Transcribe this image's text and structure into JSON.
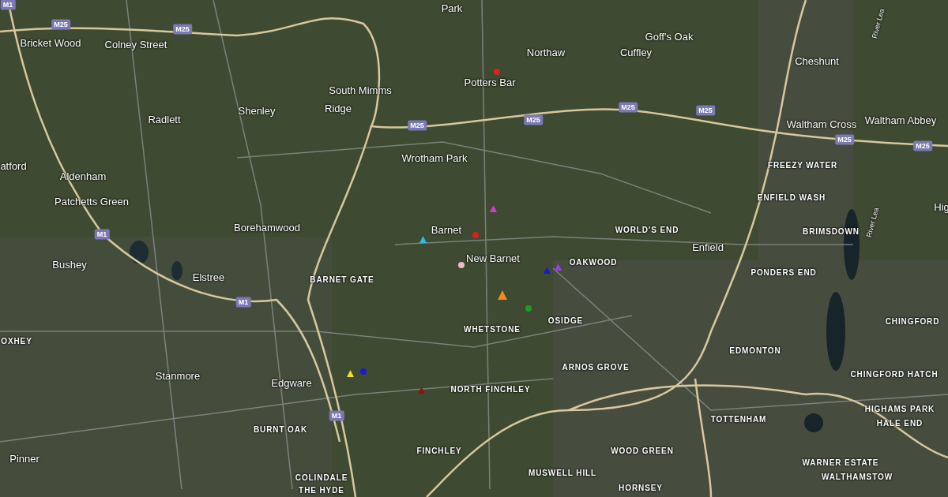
{
  "map": {
    "labels": [
      {
        "text": "Park",
        "kind": "town"
      },
      {
        "text": "Bricket Wood",
        "kind": "town"
      },
      {
        "text": "Colney Street",
        "kind": "town"
      },
      {
        "text": "Goff's Oak",
        "kind": "town"
      },
      {
        "text": "Northaw",
        "kind": "town"
      },
      {
        "text": "Cuffley",
        "kind": "town"
      },
      {
        "text": "Cheshunt",
        "kind": "town"
      },
      {
        "text": "Potters Bar",
        "kind": "town"
      },
      {
        "text": "South Mimms",
        "kind": "town"
      },
      {
        "text": "Shenley",
        "kind": "town"
      },
      {
        "text": "Ridge",
        "kind": "town"
      },
      {
        "text": "Radlett",
        "kind": "town"
      },
      {
        "text": "Waltham Cross",
        "kind": "town"
      },
      {
        "text": "Waltham Abbey",
        "kind": "town"
      },
      {
        "text": "Wrotham Park",
        "kind": "town"
      },
      {
        "text": "atford",
        "kind": "town"
      },
      {
        "text": "Aldenham",
        "kind": "town"
      },
      {
        "text": "Patchetts Green",
        "kind": "town"
      },
      {
        "text": "Borehamwood",
        "kind": "town"
      },
      {
        "text": "Barnet",
        "kind": "town"
      },
      {
        "text": "New Barnet",
        "kind": "town"
      },
      {
        "text": "Enfield",
        "kind": "town"
      },
      {
        "text": "Bushey",
        "kind": "town"
      },
      {
        "text": "Elstree",
        "kind": "town"
      },
      {
        "text": "Stanmore",
        "kind": "town"
      },
      {
        "text": "Edgware",
        "kind": "town"
      },
      {
        "text": "Pinner",
        "kind": "town"
      },
      {
        "text": "Hig",
        "kind": "town"
      },
      {
        "text": "FREEZY WATER",
        "kind": "district"
      },
      {
        "text": "ENFIELD WASH",
        "kind": "district"
      },
      {
        "text": "WORLD'S END",
        "kind": "district"
      },
      {
        "text": "BRIMSDOWN",
        "kind": "district"
      },
      {
        "text": "OAKWOOD",
        "kind": "district"
      },
      {
        "text": "BARNET GATE",
        "kind": "district"
      },
      {
        "text": "PONDERS END",
        "kind": "district"
      },
      {
        "text": "WHETSTONE",
        "kind": "district"
      },
      {
        "text": "OSIDGE",
        "kind": "district"
      },
      {
        "text": "EDMONTON",
        "kind": "district"
      },
      {
        "text": "CHINGFORD",
        "kind": "district"
      },
      {
        "text": "OXHEY",
        "kind": "district"
      },
      {
        "text": "ARNOS GROVE",
        "kind": "district"
      },
      {
        "text": "NORTH FINCHLEY",
        "kind": "district"
      },
      {
        "text": "CHINGFORD HATCH",
        "kind": "district"
      },
      {
        "text": "TOTTENHAM",
        "kind": "district"
      },
      {
        "text": "BURNT OAK",
        "kind": "district"
      },
      {
        "text": "HIGHAMS PARK",
        "kind": "district"
      },
      {
        "text": "HALE END",
        "kind": "district"
      },
      {
        "text": "FINCHLEY",
        "kind": "district"
      },
      {
        "text": "WOOD GREEN",
        "kind": "district"
      },
      {
        "text": "WARNER ESTATE",
        "kind": "district"
      },
      {
        "text": "MUSWELL HILL",
        "kind": "district"
      },
      {
        "text": "COLINDALE",
        "kind": "district"
      },
      {
        "text": "THE HYDE",
        "kind": "district"
      },
      {
        "text": "WALTHAMSTOW",
        "kind": "district"
      },
      {
        "text": "HORNSEY",
        "kind": "district"
      },
      {
        "text": "River Lea",
        "kind": "river"
      },
      {
        "text": "River Lea",
        "kind": "river"
      },
      {
        "text": "M1",
        "kind": "shield"
      },
      {
        "text": "M25",
        "kind": "shield"
      },
      {
        "text": "M25",
        "kind": "shield"
      },
      {
        "text": "M25",
        "kind": "shield"
      },
      {
        "text": "M25",
        "kind": "shield"
      },
      {
        "text": "M25",
        "kind": "shield"
      },
      {
        "text": "M25",
        "kind": "shield"
      },
      {
        "text": "M25",
        "kind": "shield"
      },
      {
        "text": "M25",
        "kind": "shield"
      },
      {
        "text": "M1",
        "kind": "shield"
      },
      {
        "text": "M1",
        "kind": "shield"
      },
      {
        "text": "M1",
        "kind": "shield"
      }
    ],
    "markers": [
      {
        "kind": "dot",
        "color": "#e0201c"
      },
      {
        "kind": "triangle",
        "color": "#d438d4"
      },
      {
        "kind": "dot",
        "color": "#d81f1f"
      },
      {
        "kind": "triangle",
        "color": "#35b4e8"
      },
      {
        "kind": "dot",
        "color": "#f2b8c6"
      },
      {
        "kind": "triangle",
        "color": "#1a1ad0"
      },
      {
        "kind": "triangle",
        "color": "#9a3ee0"
      },
      {
        "kind": "triangle",
        "color": "#f08a1c"
      },
      {
        "kind": "dot",
        "color": "#1f9a2a"
      },
      {
        "kind": "triangle",
        "color": "#f0e020"
      },
      {
        "kind": "dot",
        "color": "#1a1ad0"
      },
      {
        "kind": "triangle",
        "color": "#8a1414"
      }
    ]
  }
}
